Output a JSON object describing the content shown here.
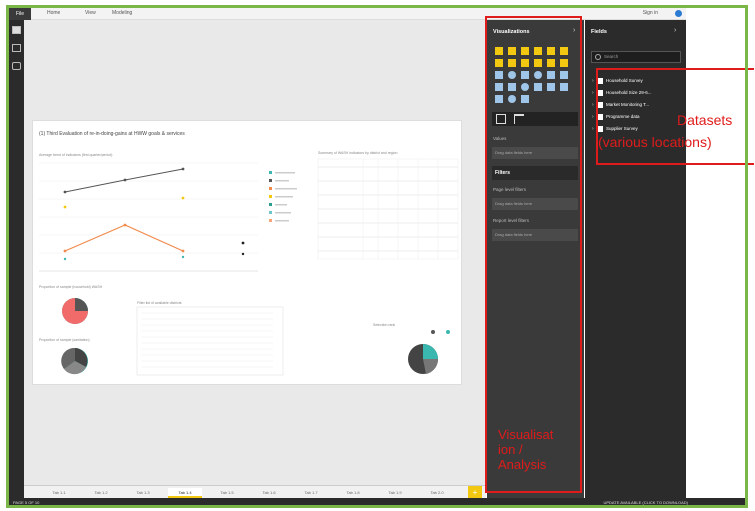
{
  "ribbon": {
    "tabs": [
      "File",
      "Home",
      "View",
      "Modeling"
    ],
    "sign_in": "Sign in"
  },
  "report": {
    "title": "(1) Third Evaluation of re-in-doing-gains at HWW goals & services",
    "sub_labels": [
      "Average trend of indicators (first quarter/period)",
      "Summary of WASH indicators by district and region",
      "Proportion of sample (household) WASH",
      "Proportion of sample (sanitation)",
      "Filter list of available districts",
      "Selection rank"
    ]
  },
  "page_tabs": [
    "Tab 1.1",
    "Tab 1.2",
    "Tab 1.3",
    "Tab 1.4",
    "Tab 1.5",
    "Tab 1.6",
    "Tab 1.7",
    "Tab 1.8",
    "Tab 1.9",
    "Tab 2.0"
  ],
  "page_tabs_add": "+",
  "status": {
    "left": "PAGE 5 OF 10",
    "right": "UPDATE AVAILABLE (CLICK TO DOWNLOAD)"
  },
  "visualizations": {
    "title": "Visualizations",
    "chevron": "›",
    "values_label": "Values",
    "values_drop": "Drag data fields here",
    "filters_title": "Filters",
    "page_level": "Page level filters",
    "page_level_drop": "Drag data fields here",
    "report_level": "Report level filters",
    "report_level_drop": "Drag data fields here"
  },
  "fields": {
    "title": "Fields",
    "chevron": "›",
    "search_placeholder": "Search",
    "datasets": [
      "Household Survey",
      "Household Size 29-6...",
      "Market Monitoring T...",
      "Programme data",
      "Supplier Survey"
    ]
  },
  "annotations": {
    "datasets_line1": "Datasets",
    "datasets_line2": "(various locations)",
    "viz_line1": "Visualisat",
    "viz_line2": "ion /",
    "viz_line3": "Analysis"
  },
  "colors": {
    "annotation_red": "#e01b1b",
    "outer_border_green": "#7ab648",
    "accent_yellow": "#f2c811",
    "pane_dark": "#3a3a3a",
    "fields_dark": "#2b2b2b"
  }
}
